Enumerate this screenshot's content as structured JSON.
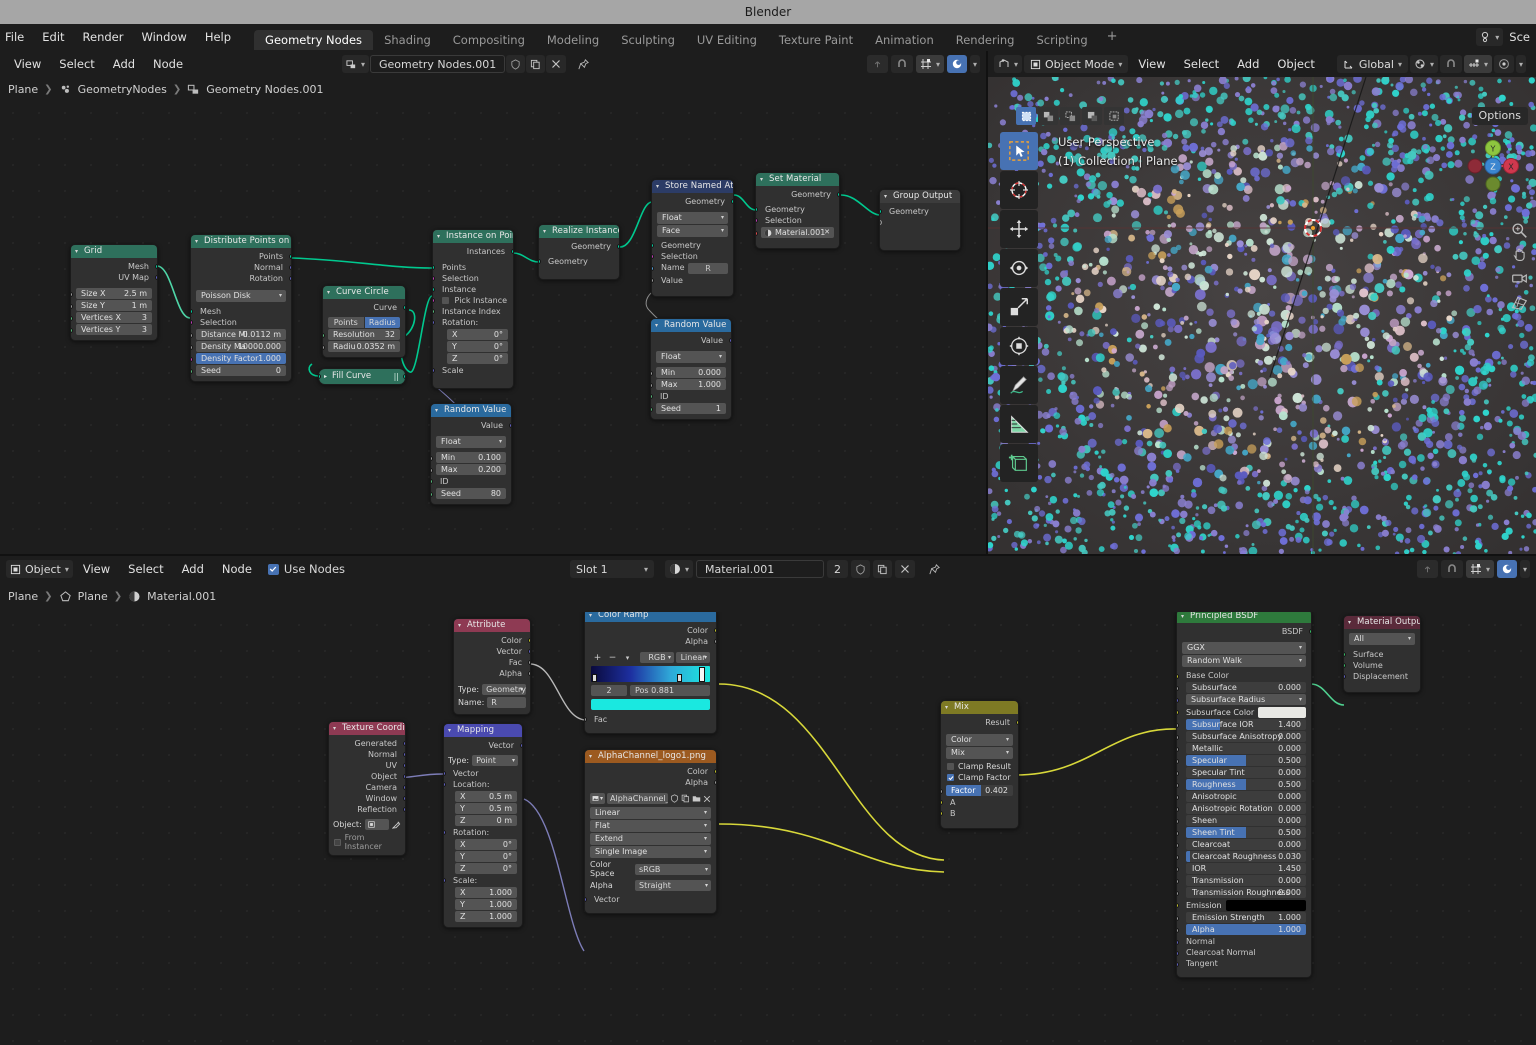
{
  "window": {
    "title": "Blender"
  },
  "topbar": {
    "menus": [
      "File",
      "Edit",
      "Render",
      "Window",
      "Help"
    ],
    "workspaces": [
      "Geometry Nodes",
      "Shading",
      "Compositing",
      "Modeling",
      "Sculpting",
      "UV Editing",
      "Texture Paint",
      "Animation",
      "Rendering",
      "Scripting"
    ],
    "active_workspace": "Geometry Nodes",
    "add_tab": "+",
    "scene_label": "Sce"
  },
  "geo_editor": {
    "menus": [
      "View",
      "Select",
      "Add",
      "Node"
    ],
    "datablock_name": "Geometry Nodes.001",
    "breadcrumb": [
      "Plane",
      "GeometryNodes",
      "Geometry Nodes.001"
    ]
  },
  "viewport": {
    "mode": "Object Mode",
    "menus": [
      "View",
      "Select",
      "Add",
      "Object"
    ],
    "transform_orientation": "Global",
    "options_label": "Options",
    "overlay_line1": "User Perspective",
    "overlay_line2": "(1) Collection | Plane",
    "gizmo_axes": [
      "X",
      "Y",
      "Z"
    ]
  },
  "shader_editor": {
    "shader_type": "Object",
    "menus": [
      "View",
      "Select",
      "Add",
      "Node"
    ],
    "use_nodes_label": "Use Nodes",
    "use_nodes_checked": true,
    "slot": "Slot 1",
    "material_name": "Material.001",
    "material_users": "2",
    "breadcrumb": [
      "Plane",
      "Plane",
      "Material.001"
    ]
  },
  "geo_nodes": [
    {
      "id": "grid",
      "title": "Grid",
      "header_color": "#2e705c",
      "outputs": [
        {
          "label": "Mesh",
          "type": "geo"
        },
        {
          "label": "UV Map",
          "type": "vec"
        }
      ],
      "fields": [
        {
          "label": "Size X",
          "value": "2.5 m",
          "type": "flt"
        },
        {
          "label": "Size Y",
          "value": "1 m",
          "type": "flt"
        },
        {
          "label": "Vertices X",
          "value": "3",
          "type": "int"
        },
        {
          "label": "Vertices Y",
          "value": "3",
          "type": "int"
        }
      ]
    },
    {
      "id": "distribute",
      "title": "Distribute Points on Faces",
      "header_color": "#2e705c",
      "outputs": [
        {
          "label": "Points",
          "type": "geo"
        },
        {
          "label": "Normal",
          "type": "vec"
        },
        {
          "label": "Rotation",
          "type": "vec"
        }
      ],
      "dropdown": "Poisson Disk",
      "inputs": [
        {
          "label": "Mesh",
          "type": "geo"
        },
        {
          "label": "Selection",
          "type": "bool"
        }
      ],
      "fields": [
        {
          "label": "Distance Mi",
          "value": "0.0112 m",
          "type": "flt"
        },
        {
          "label": "Density Ma",
          "value": "10000.000",
          "type": "flt"
        },
        {
          "label": "Density Factor",
          "value": "1.000",
          "type": "flt",
          "highlight": true
        },
        {
          "label": "Seed",
          "value": "0",
          "type": "int"
        }
      ]
    },
    {
      "id": "curvecircle",
      "title": "Curve Circle",
      "header_color": "#2e705c",
      "outputs": [
        {
          "label": "Curve",
          "type": "geo"
        }
      ],
      "tabs": [
        "Points",
        "Radius"
      ],
      "active_tab": "Radius",
      "fields": [
        {
          "label": "Resolution",
          "value": "32",
          "type": "int"
        },
        {
          "label": "Radiu",
          "value": "0.0352 m",
          "type": "flt"
        }
      ]
    },
    {
      "id": "fillcurve",
      "title": "Fill Curve",
      "header_color": "#2e705c",
      "collapsed": true
    },
    {
      "id": "instance",
      "title": "Instance on Points",
      "header_color": "#2e705c",
      "outputs": [
        {
          "label": "Instances",
          "type": "geo"
        }
      ],
      "inputs": [
        {
          "label": "Points",
          "type": "geo"
        },
        {
          "label": "Selection",
          "type": "bool"
        },
        {
          "label": "Instance",
          "type": "geo"
        },
        {
          "label": "Pick Instance",
          "type": "bool",
          "checkbox": true
        },
        {
          "label": "Instance Index",
          "type": "int"
        },
        {
          "label": "Rotation:",
          "type": "vec"
        }
      ],
      "vector_fields": [
        {
          "label": "X",
          "value": "0°"
        },
        {
          "label": "Y",
          "value": "0°"
        },
        {
          "label": "Z",
          "value": "0°"
        }
      ],
      "trailing_input": {
        "label": "Scale",
        "type": "vec"
      }
    },
    {
      "id": "randomvalue1",
      "title": "Random Value",
      "header_color": "#2a6a9e",
      "outputs": [
        {
          "label": "Value",
          "type": "vec"
        }
      ],
      "dropdown": "Float",
      "fields": [
        {
          "label": "Min",
          "value": "0.100",
          "type": "flt"
        },
        {
          "label": "Max",
          "value": "0.200",
          "type": "flt"
        }
      ],
      "plain_inputs": [
        {
          "label": "ID",
          "type": "int"
        }
      ],
      "tail_fields": [
        {
          "label": "Seed",
          "value": "80",
          "type": "int"
        }
      ]
    },
    {
      "id": "realize",
      "title": "Realize Instances",
      "header_color": "#2e705c",
      "outputs": [
        {
          "label": "Geometry",
          "type": "geo"
        }
      ],
      "inputs": [
        {
          "label": "Geometry",
          "type": "geo"
        }
      ]
    },
    {
      "id": "storenamed",
      "title": "Store Named Attribute",
      "header_color": "#2c3c66",
      "outputs": [
        {
          "label": "Geometry",
          "type": "geo"
        }
      ],
      "dropdowns": [
        "Float",
        "Face"
      ],
      "inputs": [
        {
          "label": "Geometry",
          "type": "geo"
        },
        {
          "label": "Selection",
          "type": "bool"
        }
      ],
      "name_field": {
        "label": "Name",
        "value": "R",
        "type": "str"
      },
      "value_input": {
        "label": "Value",
        "type": "flt"
      }
    },
    {
      "id": "setmaterial",
      "title": "Set Material",
      "header_color": "#2e705c",
      "outputs": [
        {
          "label": "Geometry",
          "type": "geo"
        }
      ],
      "inputs": [
        {
          "label": "Geometry",
          "type": "geo"
        },
        {
          "label": "Selection",
          "type": "bool"
        }
      ],
      "material_field": {
        "value": "Material.001",
        "type": "mat"
      }
    },
    {
      "id": "groupoutput",
      "title": "Group Output",
      "header_color": "#3c3c3c",
      "inputs": [
        {
          "label": "Geometry",
          "type": "geo"
        },
        {
          "label": "",
          "type": "open"
        }
      ]
    },
    {
      "id": "randomvalue2",
      "title": "Random Value",
      "header_color": "#2a6a9e",
      "outputs": [
        {
          "label": "Value",
          "type": "vec"
        }
      ],
      "dropdown": "Float",
      "fields": [
        {
          "label": "Min",
          "value": "0.000",
          "type": "flt"
        },
        {
          "label": "Max",
          "value": "1.000",
          "type": "flt"
        }
      ],
      "plain_inputs": [
        {
          "label": "ID",
          "type": "int"
        }
      ],
      "tail_fields": [
        {
          "label": "Seed",
          "value": "1",
          "type": "int"
        }
      ]
    }
  ],
  "shader_nodes": [
    {
      "id": "texcoord",
      "title": "Texture Coordinate",
      "header_color": "#8e3a53",
      "outputs": [
        "Generated",
        "Normal",
        "UV",
        "Object",
        "Camera",
        "Window",
        "Reflection"
      ],
      "object_label": "Object:",
      "from_instancer_label": "From Instancer"
    },
    {
      "id": "mapping",
      "title": "Mapping",
      "header_color": "#4a4ab0",
      "outputs": [
        "Vector"
      ],
      "type_label": "Type:",
      "type_value": "Point",
      "input_label": "Vector",
      "location_label": "Location:",
      "location": [
        {
          "axis": "X",
          "value": "0.5 m"
        },
        {
          "axis": "Y",
          "value": "0.5 m"
        },
        {
          "axis": "Z",
          "value": "0 m"
        }
      ],
      "rotation_label": "Rotation:",
      "rotation": [
        {
          "axis": "X",
          "value": "0°"
        },
        {
          "axis": "Y",
          "value": "0°"
        },
        {
          "axis": "Z",
          "value": "0°"
        }
      ],
      "scale_label": "Scale:",
      "scale": [
        {
          "axis": "X",
          "value": "1.000"
        },
        {
          "axis": "Y",
          "value": "1.000"
        },
        {
          "axis": "Z",
          "value": "1.000"
        }
      ]
    },
    {
      "id": "attribute",
      "title": "Attribute",
      "header_color": "#8e3a53",
      "outputs": [
        "Color",
        "Vector",
        "Fac",
        "Alpha"
      ],
      "type_label": "Type:",
      "type_value": "Geometry",
      "name_label": "Name:",
      "name_value": "R"
    },
    {
      "id": "colorramp",
      "title": "Color Ramp",
      "header_color": "#2a6a9e",
      "outputs": [
        "Color",
        "Alpha"
      ],
      "color_mode": "RGB",
      "interpolation": "Linear",
      "index": "2",
      "pos_label": "Pos",
      "pos_value": "0.881",
      "swatch_color": "#1ae8e0",
      "input_label": "Fac",
      "gradient": [
        "#0a0a3c",
        "#1d2fa0",
        "#2fa8d8",
        "#1ae8e0"
      ]
    },
    {
      "id": "imagetex",
      "title": "AlphaChannel_logo1.png",
      "header_color": "#9c5a20",
      "outputs": [
        "Color",
        "Alpha"
      ],
      "image_name": "AlphaChannel_logo...",
      "dropdowns": [
        "Linear",
        "Flat",
        "Extend",
        "Single Image"
      ],
      "colorspace_label": "Color Space",
      "colorspace_value": "sRGB",
      "alpha_label": "Alpha",
      "alpha_value": "Straight",
      "input_label": "Vector"
    },
    {
      "id": "mix",
      "title": "Mix",
      "header_color": "#7e7a24",
      "outputs": [
        "Result"
      ],
      "data_type": "Color",
      "blend_mode": "Mix",
      "clamp_result_label": "Clamp Result",
      "clamp_result": false,
      "clamp_factor_label": "Clamp Factor",
      "clamp_factor": true,
      "factor_label": "Factor",
      "factor_value": "0.402",
      "inputs": [
        "A",
        "B"
      ]
    },
    {
      "id": "principled",
      "title": "Principled BSDF",
      "header_color": "#2e7a3c",
      "outputs": [
        "BSDF"
      ],
      "dropdowns": [
        "GGX",
        "Random Walk"
      ],
      "props": [
        {
          "label": "Base Color",
          "value": "",
          "kind": "socket-col"
        },
        {
          "label": "Subsurface",
          "value": "0.000",
          "kind": "slider",
          "fill": 0
        },
        {
          "label": "Subsurface Radius",
          "value": "",
          "kind": "drop"
        },
        {
          "label": "Subsurface Color",
          "value": "",
          "kind": "swatch",
          "color": "#e8e8e4"
        },
        {
          "label": "Subsurface IOR",
          "value": "1.400",
          "kind": "slider",
          "fill": 28
        },
        {
          "label": "Subsurface Anisotropy",
          "value": "0.000",
          "kind": "slider",
          "fill": 0
        },
        {
          "label": "Metallic",
          "value": "0.000",
          "kind": "slider",
          "fill": 0
        },
        {
          "label": "Specular",
          "value": "0.500",
          "kind": "slider",
          "fill": 50
        },
        {
          "label": "Specular Tint",
          "value": "0.000",
          "kind": "slider",
          "fill": 0
        },
        {
          "label": "Roughness",
          "value": "0.500",
          "kind": "slider",
          "fill": 50
        },
        {
          "label": "Anisotropic",
          "value": "0.000",
          "kind": "slider",
          "fill": 0
        },
        {
          "label": "Anisotropic Rotation",
          "value": "0.000",
          "kind": "slider",
          "fill": 0
        },
        {
          "label": "Sheen",
          "value": "0.000",
          "kind": "slider",
          "fill": 0
        },
        {
          "label": "Sheen Tint",
          "value": "0.500",
          "kind": "slider",
          "fill": 50
        },
        {
          "label": "Clearcoat",
          "value": "0.000",
          "kind": "slider",
          "fill": 0
        },
        {
          "label": "Clearcoat Roughness",
          "value": "0.030",
          "kind": "slider",
          "fill": 3
        },
        {
          "label": "IOR",
          "value": "1.450",
          "kind": "slider",
          "fill": 0
        },
        {
          "label": "Transmission",
          "value": "0.000",
          "kind": "slider",
          "fill": 0
        },
        {
          "label": "Transmission Roughness",
          "value": "0.000",
          "kind": "slider",
          "fill": 0
        },
        {
          "label": "Emission",
          "value": "",
          "kind": "swatch",
          "color": "#000000"
        },
        {
          "label": "Emission Strength",
          "value": "1.000",
          "kind": "slider",
          "fill": 0
        },
        {
          "label": "Alpha",
          "value": "1.000",
          "kind": "slider",
          "fill": 100
        },
        {
          "label": "Normal",
          "value": "",
          "kind": "socket-vec"
        },
        {
          "label": "Clearcoat Normal",
          "value": "",
          "kind": "socket-vec"
        },
        {
          "label": "Tangent",
          "value": "",
          "kind": "socket-vec"
        }
      ]
    },
    {
      "id": "matoutput",
      "title": "Material Output",
      "header_color": "#5a2a3a",
      "dropdown": "All",
      "inputs": [
        "Surface",
        "Volume",
        "Displacement"
      ]
    }
  ],
  "icons": {
    "cursor": "cursor-icon",
    "move": "move-icon",
    "rotate": "rotate-icon",
    "scale": "scale-icon",
    "transform": "transform-icon",
    "annotate": "annotate-icon",
    "measure": "measure-icon",
    "add_cube": "add-cube-icon",
    "shield": "shield-icon",
    "copy": "copy-icon",
    "close": "close-icon",
    "pin": "pin-icon"
  }
}
